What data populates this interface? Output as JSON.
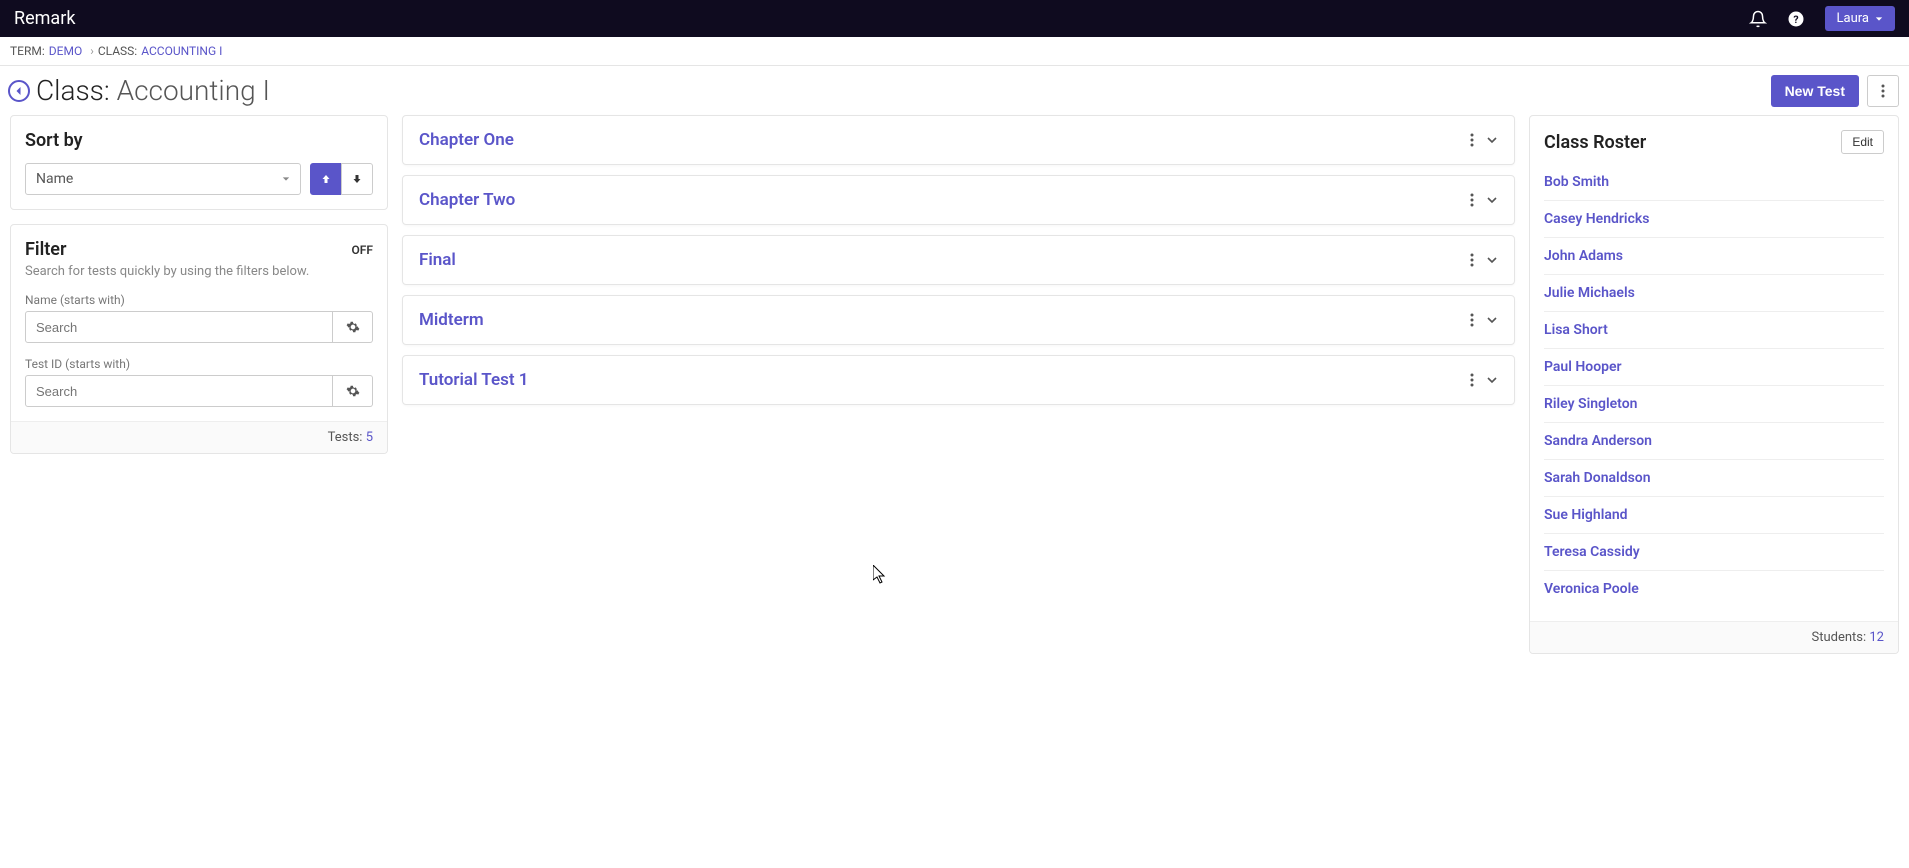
{
  "header": {
    "brand": "Remark",
    "user": "Laura"
  },
  "breadcrumb": {
    "term_label": "TERM:",
    "term_value": "DEMO",
    "class_label": "CLASS:",
    "class_value": "ACCOUNTING I"
  },
  "page": {
    "title_prefix": "Class: ",
    "title_value": "Accounting I",
    "new_test_label": "New Test"
  },
  "sort": {
    "title": "Sort by",
    "selected": "Name"
  },
  "filter": {
    "title": "Filter",
    "status": "OFF",
    "description": "Search for tests quickly by using the filters below.",
    "name_label": "Name (starts with)",
    "name_placeholder": "Search",
    "testid_label": "Test ID (starts with)",
    "testid_placeholder": "Search",
    "tests_label": "Tests:",
    "tests_count": "5"
  },
  "tests": [
    "Chapter One",
    "Chapter Two",
    "Final",
    "Midterm",
    "Tutorial Test 1"
  ],
  "roster": {
    "title": "Class Roster",
    "edit_label": "Edit",
    "students_label": "Students:",
    "students_count": "12",
    "items": [
      "Bob Smith",
      "Casey Hendricks",
      "John Adams",
      "Julie Michaels",
      "Lisa Short",
      "Paul Hooper",
      "Riley Singleton",
      "Sandra Anderson",
      "Sarah Donaldson",
      "Sue Highland",
      "Teresa Cassidy",
      "Veronica Poole"
    ]
  }
}
